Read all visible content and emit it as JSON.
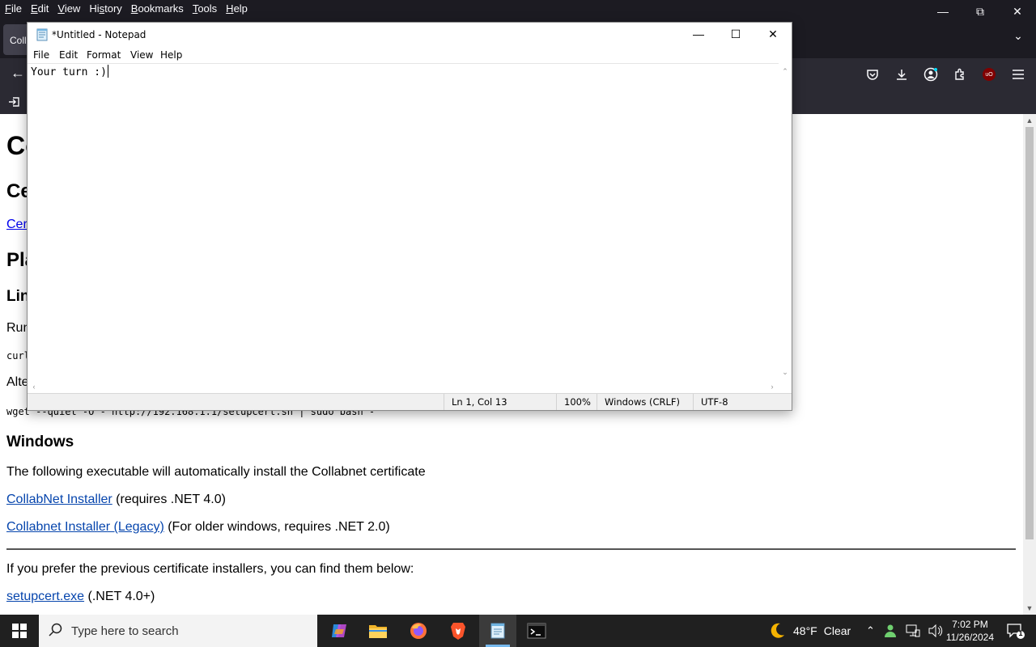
{
  "browser": {
    "menu": [
      {
        "pre": "",
        "u": "F",
        "post": "ile"
      },
      {
        "pre": "",
        "u": "E",
        "post": "dit"
      },
      {
        "pre": "",
        "u": "V",
        "post": "iew"
      },
      {
        "pre": "Hi",
        "u": "s",
        "post": "tory"
      },
      {
        "pre": "",
        "u": "B",
        "post": "ookmarks"
      },
      {
        "pre": "",
        "u": "T",
        "post": "ools"
      },
      {
        "pre": "",
        "u": "H",
        "post": "elp"
      }
    ],
    "tab_label": "Coll",
    "bookmark_first": "",
    "toolbar_icons": [
      "pocket-icon",
      "download-icon",
      "account-icon",
      "extensions-icon",
      "ublock-icon",
      "hamburger-menu-icon"
    ],
    "ublock_text": "uO"
  },
  "page": {
    "h1": "Co",
    "h2_cert": "Ce",
    "cert_link": "Cer",
    "h2_platform": "Pla",
    "h3_linux": "Lin",
    "p_run": "Run",
    "code_curl": "curl",
    "p_alt": "Alte",
    "code_wget": "wget --quiet -O - http://192.168.1.1/setupcert.sh | sudo bash -",
    "h3_windows": "Windows",
    "p_following": "The following executable will automatically install the Collabnet certificate",
    "link_installer": "CollabNet Installer",
    "installer_note": " (requires .NET 4.0)",
    "link_legacy": "Collabnet Installer (Legacy)",
    "legacy_note": " (For older windows, requires .NET 2.0)",
    "p_prefer": "If you prefer the previous certificate installers, you can find them below:",
    "link_setupcert": "setupcert.exe",
    "setupcert_note": " (.NET 4.0+)"
  },
  "notepad": {
    "title": "*Untitled - Notepad",
    "menu": [
      "File",
      "Edit",
      "Format",
      "View",
      "Help"
    ],
    "content": "Your turn :)",
    "status": {
      "position": "Ln 1, Col 13",
      "zoom": "100%",
      "line_ending": "Windows (CRLF)",
      "encoding": "UTF-8"
    }
  },
  "taskbar": {
    "search_placeholder": "Type here to search",
    "apps": [
      "copilot-icon",
      "file-explorer-icon",
      "firefox-icon",
      "brave-icon",
      "notepad-icon",
      "terminal-icon"
    ],
    "weather_temp": "48°F",
    "weather_desc": "Clear",
    "time": "7:02 PM",
    "date": "11/26/2024",
    "notification_count": "1"
  }
}
